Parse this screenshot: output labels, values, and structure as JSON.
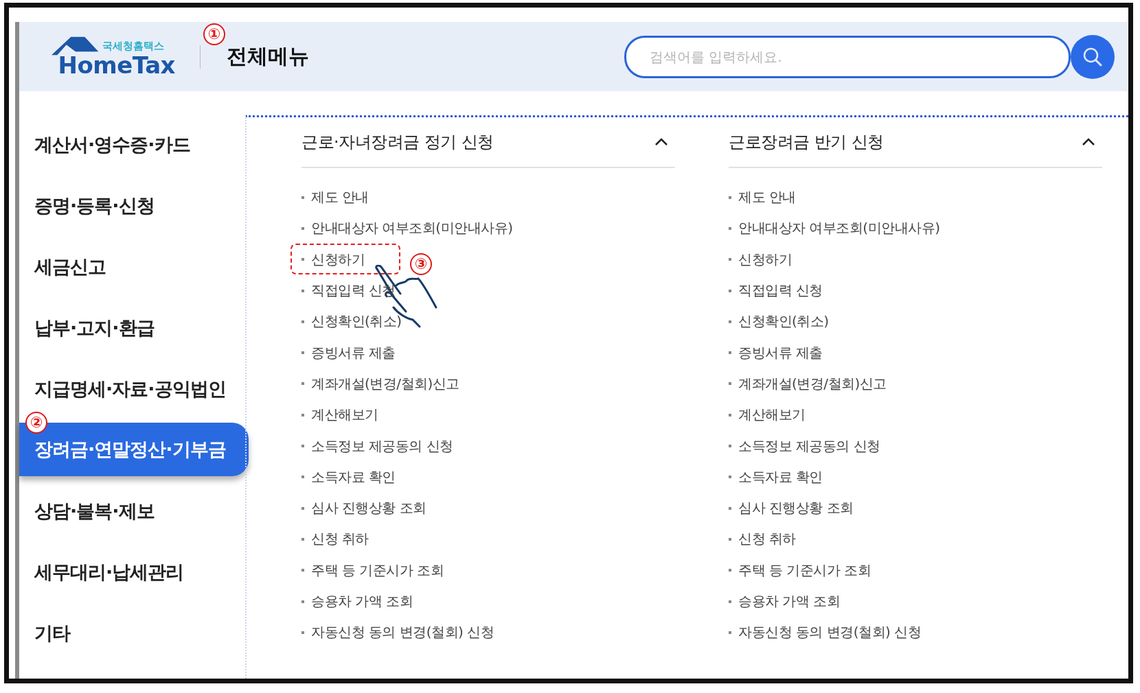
{
  "header": {
    "logo": {
      "tagline": "국세청홈택스",
      "name": "HomeTax"
    },
    "title": "전체메뉴",
    "search": {
      "placeholder": "검색어를 입력하세요."
    }
  },
  "sidebar": {
    "items": [
      {
        "label": "계산서·영수증·카드",
        "selected": false
      },
      {
        "label": "증명·등록·신청",
        "selected": false
      },
      {
        "label": "세금신고",
        "selected": false
      },
      {
        "label": "납부·고지·환급",
        "selected": false
      },
      {
        "label": "지급명세·자료·공익법인",
        "selected": false
      },
      {
        "label": "장려금·연말정산·기부금",
        "selected": true
      },
      {
        "label": "상담·불복·제보",
        "selected": false
      },
      {
        "label": "세무대리·납세관리",
        "selected": false
      },
      {
        "label": "기타",
        "selected": false
      }
    ]
  },
  "columns": [
    {
      "title": "근로·자녀장려금 정기 신청",
      "expanded": true,
      "items": [
        {
          "label": "제도 안내",
          "highlighted": false
        },
        {
          "label": "안내대상자 여부조회(미안내사유)",
          "highlighted": false
        },
        {
          "label": "신청하기",
          "highlighted": true
        },
        {
          "label": "직접입력 신청",
          "highlighted": false
        },
        {
          "label": "신청확인(취소)",
          "highlighted": false
        },
        {
          "label": "증빙서류 제출",
          "highlighted": false
        },
        {
          "label": "계좌개설(변경/철회)신고",
          "highlighted": false
        },
        {
          "label": "계산해보기",
          "highlighted": false
        },
        {
          "label": "소득정보 제공동의 신청",
          "highlighted": false
        },
        {
          "label": "소득자료 확인",
          "highlighted": false
        },
        {
          "label": "심사 진행상황 조회",
          "highlighted": false
        },
        {
          "label": "신청 취하",
          "highlighted": false
        },
        {
          "label": "주택 등 기준시가 조회",
          "highlighted": false
        },
        {
          "label": "승용차 가액 조회",
          "highlighted": false
        },
        {
          "label": "자동신청 동의 변경(철회) 신청",
          "highlighted": false
        }
      ]
    },
    {
      "title": "근로장려금 반기 신청",
      "expanded": true,
      "items": [
        {
          "label": "제도 안내",
          "highlighted": false
        },
        {
          "label": "안내대상자 여부조회(미안내사유)",
          "highlighted": false
        },
        {
          "label": "신청하기",
          "highlighted": false
        },
        {
          "label": "직접입력 신청",
          "highlighted": false
        },
        {
          "label": "신청확인(취소)",
          "highlighted": false
        },
        {
          "label": "증빙서류 제출",
          "highlighted": false
        },
        {
          "label": "계좌개설(변경/철회)신고",
          "highlighted": false
        },
        {
          "label": "계산해보기",
          "highlighted": false
        },
        {
          "label": "소득정보 제공동의 신청",
          "highlighted": false
        },
        {
          "label": "소득자료 확인",
          "highlighted": false
        },
        {
          "label": "심사 진행상황 조회",
          "highlighted": false
        },
        {
          "label": "신청 취하",
          "highlighted": false
        },
        {
          "label": "주택 등 기준시가 조회",
          "highlighted": false
        },
        {
          "label": "승용차 가액 조회",
          "highlighted": false
        },
        {
          "label": "자동신청 동의 변경(철회) 신청",
          "highlighted": false
        }
      ]
    }
  ],
  "annotations": [
    {
      "label": "①"
    },
    {
      "label": "②"
    },
    {
      "label": "③"
    }
  ]
}
